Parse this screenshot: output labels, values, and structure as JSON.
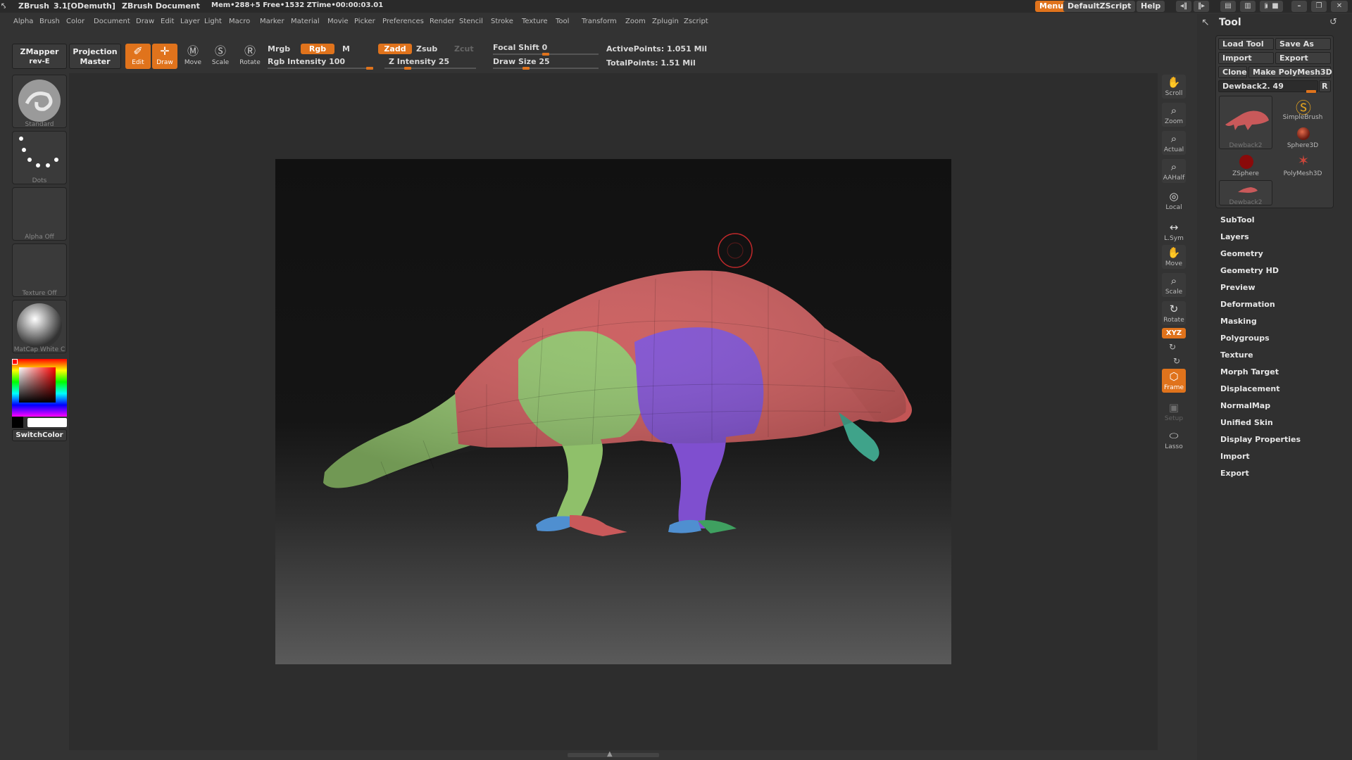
{
  "titlebar": {
    "app": "ZBrush",
    "version": "3.1[ODemuth]",
    "doc": "ZBrush Document",
    "mem": "Mem•288+5 Free•1532 ZTime•00:00:03.01",
    "menus_btn": "Menus",
    "script_btn": "DefaultZScript",
    "help_btn": "Help"
  },
  "menu": [
    "Alpha",
    "Brush",
    "Color",
    "Document",
    "Draw",
    "Edit",
    "Layer",
    "Light",
    "Macro",
    "Marker",
    "Material",
    "Movie",
    "Picker",
    "Preferences",
    "Render",
    "Stencil",
    "Stroke",
    "Texture",
    "Tool",
    "Transform",
    "Zoom",
    "Zplugin",
    "Zscript"
  ],
  "toolbar": {
    "zmapper": "ZMapper",
    "zmapper_sub": "rev-E",
    "projection": "Projection",
    "projection_sub": "Master",
    "edit": "Edit",
    "draw": "Draw",
    "move": "Move",
    "scale": "Scale",
    "rotate": "Rotate",
    "mrgb": "Mrgb",
    "rgb": "Rgb",
    "m": "M",
    "rgb_intensity": "Rgb Intensity 100",
    "zadd": "Zadd",
    "zsub": "Zsub",
    "zcut": "Zcut",
    "z_intensity": "Z Intensity 25",
    "focal_shift": "Focal Shift 0",
    "draw_size": "Draw Size 25",
    "active_points": "ActivePoints: 1.051  Mil",
    "total_points": "TotalPoints: 1.51  Mil"
  },
  "left_shelf": {
    "brush": "Standard",
    "stroke": "Dots",
    "alpha": "Alpha  Off",
    "texture": "Texture  Off",
    "material": "MatCap  White  C",
    "switch_color": "SwitchColor"
  },
  "right_shelf": [
    "Scroll",
    "Zoom",
    "Actual",
    "AAHalf",
    "Local",
    "L.Sym",
    "Move",
    "Scale",
    "Rotate",
    "Frame",
    "Setup",
    "Lasso"
  ],
  "right_shelf_xyz": "XYZ",
  "tool_panel": {
    "title": "Tool",
    "load": "Load Tool",
    "save_as": "Save As",
    "import": "Import",
    "export": "Export",
    "clone": "Clone",
    "make_polymesh": "Make PolyMesh3D",
    "current_tool": "Dewback2. 49",
    "r_btn": "R",
    "thumbs": {
      "main": "Dewback2",
      "simple": "SimpleBrush",
      "sphere": "Sphere3D",
      "zsphere": "ZSphere",
      "polymesh": "PolyMesh3D",
      "small": "Dewback2"
    },
    "subpalettes": [
      "SubTool",
      "Layers",
      "Geometry",
      "Geometry HD",
      "Preview",
      "Deformation",
      "Masking",
      "Polygroups",
      "Texture",
      "Morph Target",
      "Displacement",
      "NormalMap",
      "Unified Skin",
      "Display Properties",
      "Import",
      "Export"
    ]
  },
  "colors": {
    "accent": "#e0731c",
    "model_red": "#c9595a",
    "model_green": "#8fc06a",
    "model_purple": "#7f4fcf",
    "model_teal": "#3fa38a"
  }
}
